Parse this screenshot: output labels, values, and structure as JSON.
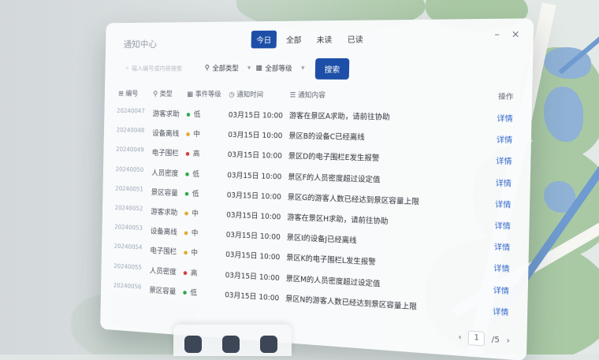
{
  "window": {
    "title": "通知中心",
    "tabs": [
      {
        "label": "今日",
        "active": true
      },
      {
        "label": "全部",
        "active": false
      },
      {
        "label": "未读",
        "active": false
      },
      {
        "label": "已读",
        "active": false
      }
    ],
    "minimize_glyph": "–",
    "close_glyph": "×"
  },
  "toolbar": {
    "search_placeholder": "输入编号或内容搜索",
    "type_filter": "全部类型",
    "level_filter": "全部等级",
    "search_button": "搜索"
  },
  "table": {
    "headers": {
      "id": "编号",
      "type": "类型",
      "level": "事件等级",
      "time": "通知时间",
      "content": "通知内容",
      "op": "操作"
    },
    "rows": [
      {
        "id": "20240047",
        "type": "游客求助",
        "level": "低",
        "level_color": "#2fa84f",
        "time": "03月15日 10:00",
        "content": "游客在景区A求助，请前往协助",
        "op": "详情"
      },
      {
        "id": "20240048",
        "type": "设备离线",
        "level": "中",
        "level_color": "#e0a92a",
        "time": "03月15日 10:00",
        "content": "景区B的设备C已经离线",
        "op": "详情"
      },
      {
        "id": "20240049",
        "type": "电子围栏",
        "level": "高",
        "level_color": "#d83b3b",
        "time": "03月15日 10:00",
        "content": "景区D的电子围栏E发生报警",
        "op": "详情"
      },
      {
        "id": "20240050",
        "type": "人员密度",
        "level": "低",
        "level_color": "#2fa84f",
        "time": "03月15日 10:00",
        "content": "景区F的人员密度超过设定值",
        "op": "详情"
      },
      {
        "id": "20240051",
        "type": "景区容量",
        "level": "低",
        "level_color": "#2fa84f",
        "time": "03月15日 10:00",
        "content": "景区G的游客人数已经达到景区容量上限",
        "op": "详情"
      },
      {
        "id": "20240052",
        "type": "游客求助",
        "level": "中",
        "level_color": "#e0a92a",
        "time": "03月15日 10:00",
        "content": "游客在景区H求助，请前往协助",
        "op": "详情"
      },
      {
        "id": "20240053",
        "type": "设备离线",
        "level": "中",
        "level_color": "#e0a92a",
        "time": "03月15日 10:00",
        "content": "景区I的设备J已经离线",
        "op": "详情"
      },
      {
        "id": "20240054",
        "type": "电子围栏",
        "level": "中",
        "level_color": "#e0a92a",
        "time": "03月15日 10:00",
        "content": "景区K的电子围栏L发生报警",
        "op": "详情"
      },
      {
        "id": "20240055",
        "type": "人员密度",
        "level": "高",
        "level_color": "#d83b3b",
        "time": "03月15日 10:00",
        "content": "景区M的人员密度超过设定值",
        "op": "详情"
      },
      {
        "id": "20240056",
        "type": "景区容量",
        "level": "低",
        "level_color": "#2fa84f",
        "time": "03月15日 10:00",
        "content": "景区N的游客人数已经达到景区容量上限",
        "op": "详情"
      }
    ]
  },
  "pager": {
    "prev": "‹",
    "current": "1",
    "total": "/5",
    "next": "›"
  },
  "colors": {
    "accent": "#1d4fa8",
    "link": "#2a62c8"
  }
}
